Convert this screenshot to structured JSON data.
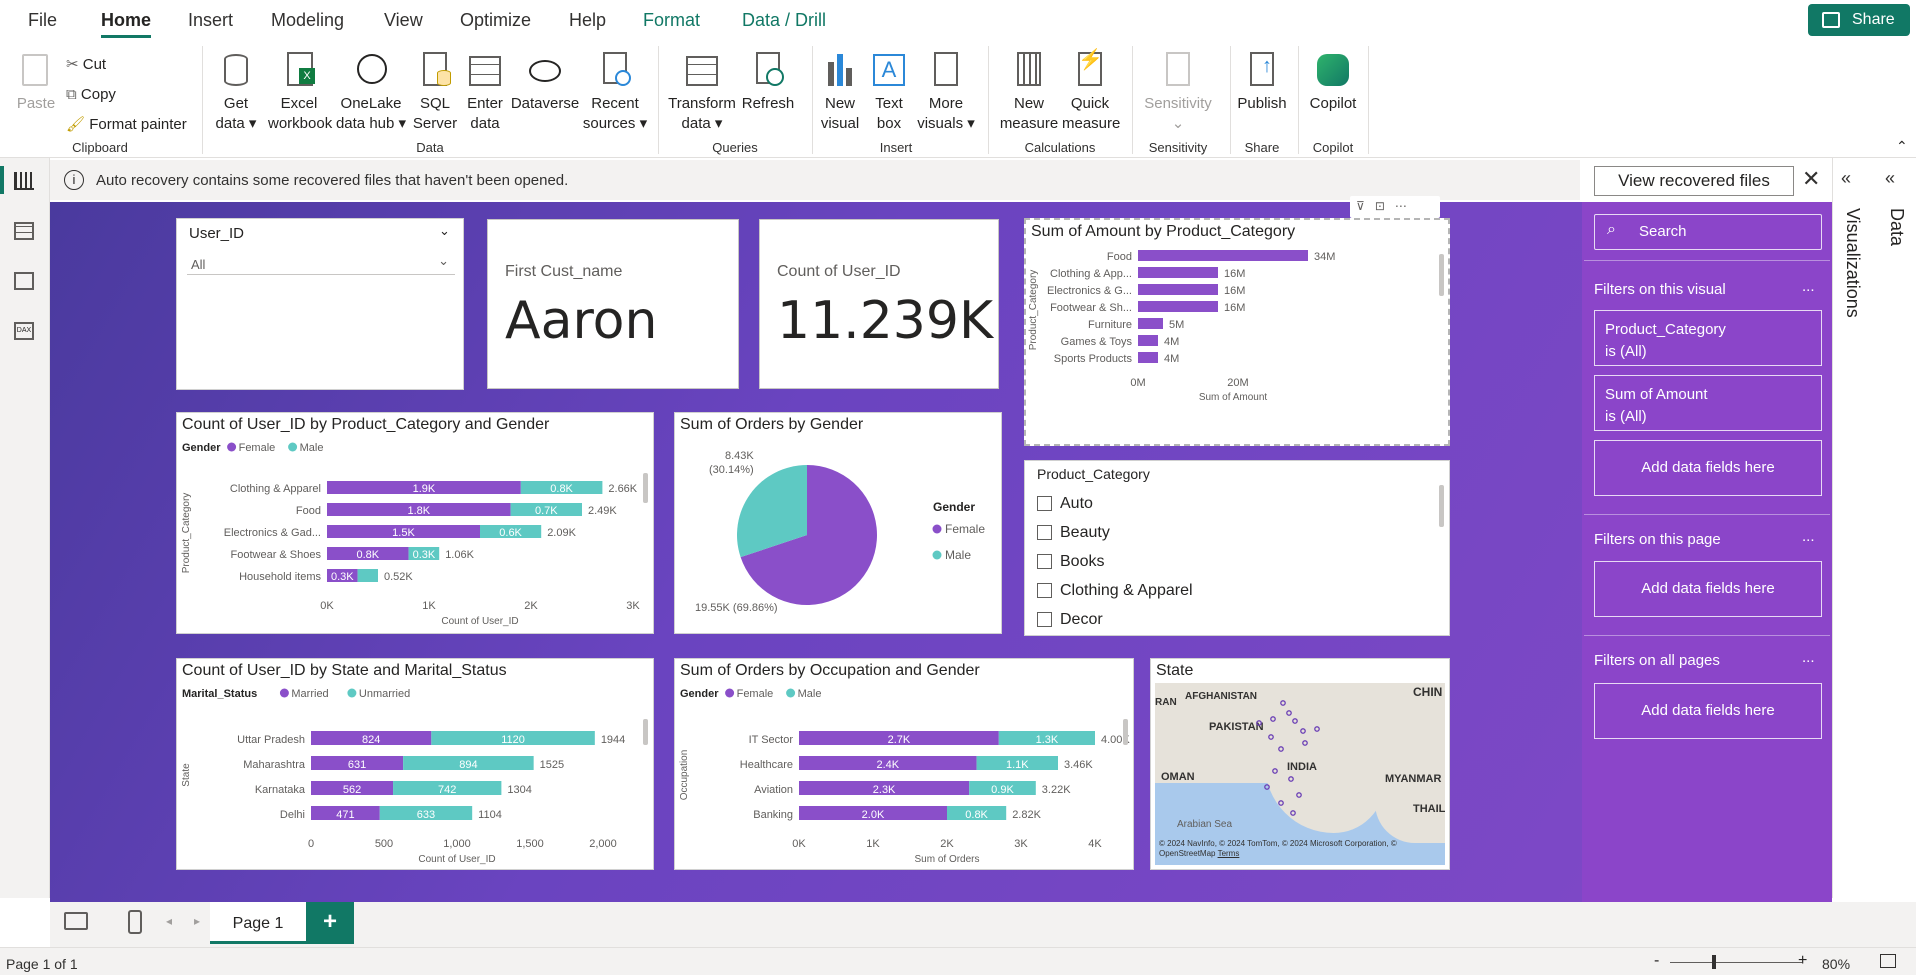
{
  "menu": {
    "file": "File",
    "home": "Home",
    "insert": "Insert",
    "modeling": "Modeling",
    "view": "View",
    "optimize": "Optimize",
    "help": "Help",
    "format": "Format",
    "data_drill": "Data / Drill",
    "share": "Share"
  },
  "ribbon": {
    "paste": "Paste",
    "cut": "Cut",
    "copy": "Copy",
    "format_painter": "Format painter",
    "clipboard": "Clipboard",
    "get_data": "Get data",
    "excel": "Excel workbook",
    "onelake": "OneLake data hub",
    "sql": "SQL Server",
    "enter_data": "Enter data",
    "dataverse": "Dataverse",
    "recent": "Recent sources",
    "data": "Data",
    "transform": "Transform data",
    "refresh": "Refresh",
    "queries": "Queries",
    "new_visual": "New visual",
    "text_box": "Text box",
    "more_visuals": "More visuals",
    "insert": "Insert",
    "new_measure": "New measure",
    "quick_measure": "Quick measure",
    "calculations": "Calculations",
    "sensitivity_btn": "Sensitivity",
    "sensitivity": "Sensitivity",
    "publish": "Publish",
    "share": "Share",
    "copilot_btn": "Copilot",
    "copilot": "Copilot"
  },
  "notification": {
    "text": "Auto recovery contains some recovered files that haven't been opened.",
    "button": "View recovered files"
  },
  "slicer_user": {
    "title": "User_ID",
    "value": "All"
  },
  "card_name": {
    "label": "First Cust_name",
    "value": "Aaron"
  },
  "card_count": {
    "label": "Count of User_ID",
    "value": "11.239K"
  },
  "product_slicer": {
    "title": "Product_Category",
    "items": [
      "Auto",
      "Beauty",
      "Books",
      "Clothing & Apparel",
      "Decor"
    ]
  },
  "filters": {
    "search": "Search",
    "on_visual": "Filters on this visual",
    "f1_name": "Product_Category",
    "f1_state": "is (All)",
    "f2_name": "Sum of Amount",
    "f2_state": "is (All)",
    "add": "Add data fields here",
    "on_page": "Filters on this page",
    "on_all": "Filters on all pages",
    "more": "..."
  },
  "rail": {
    "visualizations": "Visualizations",
    "data": "Data"
  },
  "pages": {
    "page1": "Page 1",
    "add": "+"
  },
  "status": {
    "page": "Page 1 of 1",
    "zoom": "80%",
    "minus": "-",
    "plus": "+"
  },
  "colors": {
    "female": "#8a4fc9",
    "male": "#5ec9c3",
    "canvas": "#6a44c0",
    "bar": "#8a4fc9"
  },
  "map": {
    "title": "State",
    "labels": {
      "chin": "CHIN",
      "afghanistan": "AFGHANISTAN",
      "ran": "RAN",
      "pakistan": "PAKISTAN",
      "india": "INDIA",
      "oman": "OMAN",
      "myanmar": "MYANMAR",
      "thaila": "THAILA",
      "sea": "Arabian Sea"
    },
    "credit": "© 2024 NavInfo, © 2024 TomTom, © 2024 Microsoft Corporation, © OpenStreetMap",
    "terms": "Terms"
  },
  "chart_data": [
    {
      "type": "bar",
      "title": "Sum of Amount by Product_Category",
      "ylabel": "Product_Category",
      "xlabel": "Sum of Amount",
      "categories": [
        "Food",
        "Clothing & App...",
        "Electronics & G...",
        "Footwear & Sh...",
        "Furniture",
        "Games & Toys",
        "Sports Products"
      ],
      "values": [
        34,
        16,
        16,
        16,
        5,
        4,
        4
      ],
      "labels": [
        "34M",
        "16M",
        "16M",
        "16M",
        "5M",
        "4M",
        "4M"
      ],
      "ticks": [
        "0M",
        "20M"
      ],
      "xlim": [
        0,
        38
      ]
    },
    {
      "type": "bar",
      "title": "Count of User_ID by Product_Category and Gender",
      "legend_title": "Gender",
      "ylabel": "Product_Category",
      "xlabel": "Count of User_ID",
      "categories": [
        "Clothing & Apparel",
        "Food",
        "Electronics & Gad...",
        "Footwear & Shoes",
        "Household items"
      ],
      "series": [
        {
          "name": "Female",
          "values": [
            1.9,
            1.8,
            1.5,
            0.8,
            0.3
          ],
          "labels": [
            "1.9K",
            "1.8K",
            "1.5K",
            "0.8K",
            "0.3K"
          ]
        },
        {
          "name": "Male",
          "values": [
            0.8,
            0.7,
            0.6,
            0.3,
            0.2
          ],
          "labels": [
            "0.8K",
            "0.7K",
            "0.6K",
            "0.3K",
            ""
          ]
        }
      ],
      "totals": [
        "2.66K",
        "2.49K",
        "2.09K",
        "1.06K",
        "0.52K"
      ],
      "ticks": [
        "0K",
        "1K",
        "2K",
        "3K"
      ],
      "xlim": [
        0,
        3
      ]
    },
    {
      "type": "pie",
      "title": "Sum of Orders by Gender",
      "legend_title": "Gender",
      "categories": [
        "Female",
        "Male"
      ],
      "values": [
        19.55,
        8.43
      ],
      "labels": [
        "19.55K (69.86%)",
        "8.43K (30.14%)"
      ]
    },
    {
      "type": "bar",
      "title": "Count of User_ID by State and Marital_Status",
      "legend_title": "Marital_Status",
      "ylabel": "State",
      "xlabel": "Count of User_ID",
      "categories": [
        "Uttar Pradesh",
        "Maharashtra",
        "Karnataka",
        "Delhi"
      ],
      "series": [
        {
          "name": "Married",
          "values": [
            824,
            631,
            562,
            471
          ],
          "labels": [
            "824",
            "631",
            "562",
            "471"
          ]
        },
        {
          "name": "Unmarried",
          "values": [
            1120,
            894,
            742,
            633
          ],
          "labels": [
            "1120",
            "894",
            "742",
            "633"
          ]
        }
      ],
      "totals": [
        "1944",
        "1525",
        "1304",
        "1104"
      ],
      "ticks": [
        "0",
        "500",
        "1,000",
        "1,500",
        "2,000"
      ],
      "xlim": [
        0,
        2000
      ]
    },
    {
      "type": "bar",
      "title": "Sum of Orders by Occupation and Gender",
      "legend_title": "Gender",
      "ylabel": "Occupation",
      "xlabel": "Sum of Orders",
      "categories": [
        "IT Sector",
        "Healthcare",
        "Aviation",
        "Banking"
      ],
      "series": [
        {
          "name": "Female",
          "values": [
            2.7,
            2.4,
            2.3,
            2.0
          ],
          "labels": [
            "2.7K",
            "2.4K",
            "2.3K",
            "2.0K"
          ]
        },
        {
          "name": "Male",
          "values": [
            1.3,
            1.1,
            0.9,
            0.8
          ],
          "labels": [
            "1.3K",
            "1.1K",
            "0.9K",
            "0.8K"
          ]
        }
      ],
      "totals": [
        "4.00K",
        "3.46K",
        "3.22K",
        "2.82K"
      ],
      "ticks": [
        "0K",
        "1K",
        "2K",
        "3K",
        "4K"
      ],
      "xlim": [
        0,
        4
      ]
    }
  ]
}
